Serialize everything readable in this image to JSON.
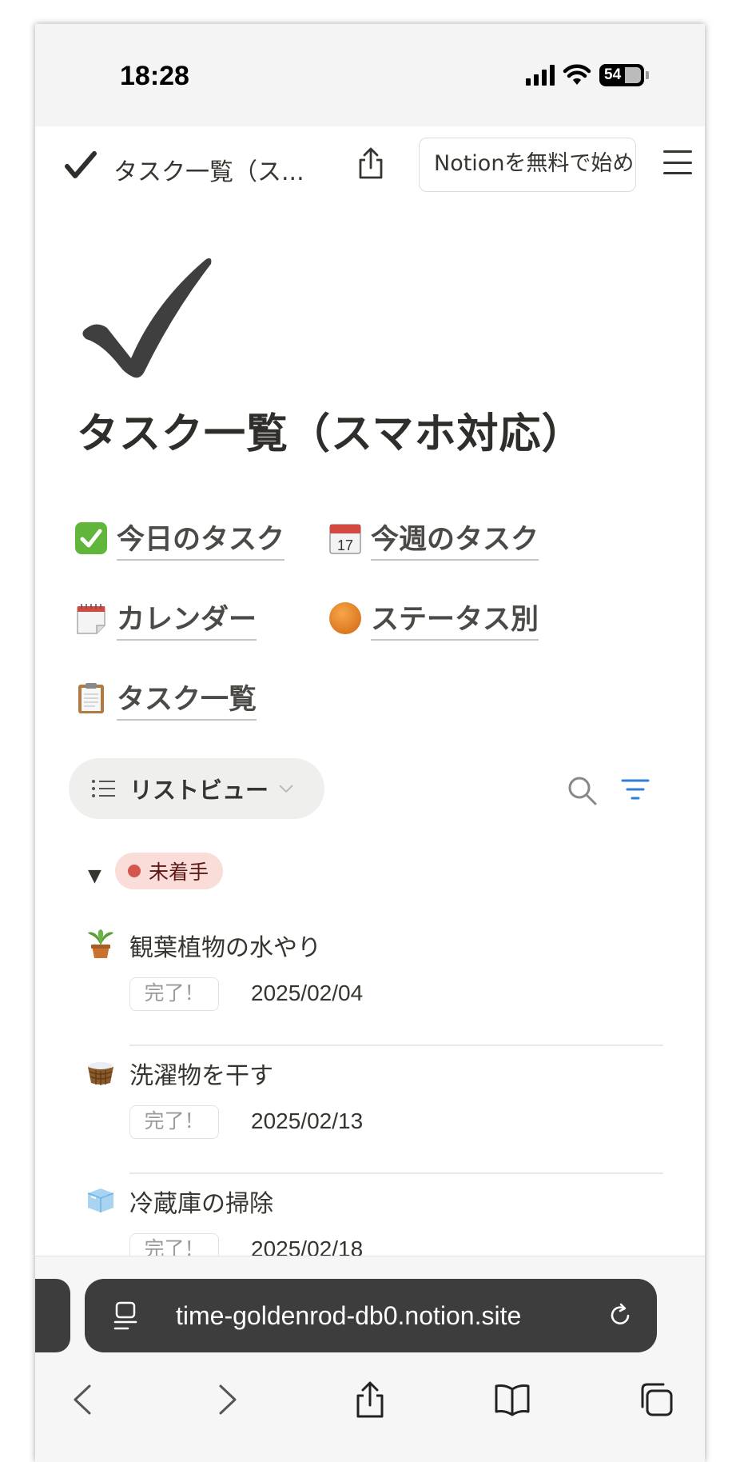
{
  "status_bar": {
    "time": "18:28",
    "battery": "54"
  },
  "top_bar": {
    "title": "タスク一覧（ス...",
    "cta": "Notionを無料で始め"
  },
  "page": {
    "title": "タスク一覧（スマホ対応）",
    "links": [
      {
        "icon": "check-mark-button-icon",
        "label": "今日のタスク"
      },
      {
        "icon": "calendar-icon",
        "label": "今週のタスク",
        "calendar_number": "17"
      },
      {
        "icon": "spiral-calendar-icon",
        "label": "カレンダー"
      },
      {
        "icon": "orange-circle-icon",
        "label": "ステータス別"
      },
      {
        "icon": "clipboard-icon",
        "label": "タスク一覧"
      }
    ]
  },
  "view": {
    "label": "リストビュー"
  },
  "group": {
    "label": "未着手",
    "color": "#d4574e"
  },
  "tasks": [
    {
      "icon": "potted-plant-icon",
      "title": "観葉植物の水やり",
      "status": "完了！",
      "date": "2025/02/04"
    },
    {
      "icon": "basket-icon",
      "title": "洗濯物を干す",
      "status": "完了！",
      "date": "2025/02/13"
    },
    {
      "icon": "ice-cube-icon",
      "title": "冷蔵庫の掃除",
      "status": "完了！",
      "date": "2025/02/18"
    }
  ],
  "browser": {
    "url": "time-goldenrod-db0.notion.site"
  },
  "colors": {
    "accent_blue": "#2f7fd8",
    "badge_bg": "#fadcd8"
  }
}
